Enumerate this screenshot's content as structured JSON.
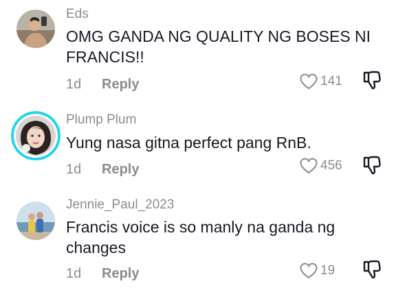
{
  "comments": [
    {
      "username": "Eds",
      "text": "OMG GANDA NG QUALITY NG BOSES NI FRANCIS!!",
      "time": "1d",
      "reply_label": "Reply",
      "likes": "141"
    },
    {
      "username": "Plump Plum",
      "text": "Yung nasa gitna perfect pang RnB.",
      "time": "1d",
      "reply_label": "Reply",
      "likes": "456"
    },
    {
      "username": "Jennie_Paul_2023",
      "text": "Francis voice is so manly na ganda ng changes",
      "time": "1d",
      "reply_label": "Reply",
      "likes": "19"
    }
  ],
  "icons": {
    "like": "heart-outline-icon",
    "dislike": "thumbs-down-icon"
  },
  "colors": {
    "text": "#161823",
    "secondary": "#8a8b91",
    "story_ring": "#20d5ec"
  }
}
